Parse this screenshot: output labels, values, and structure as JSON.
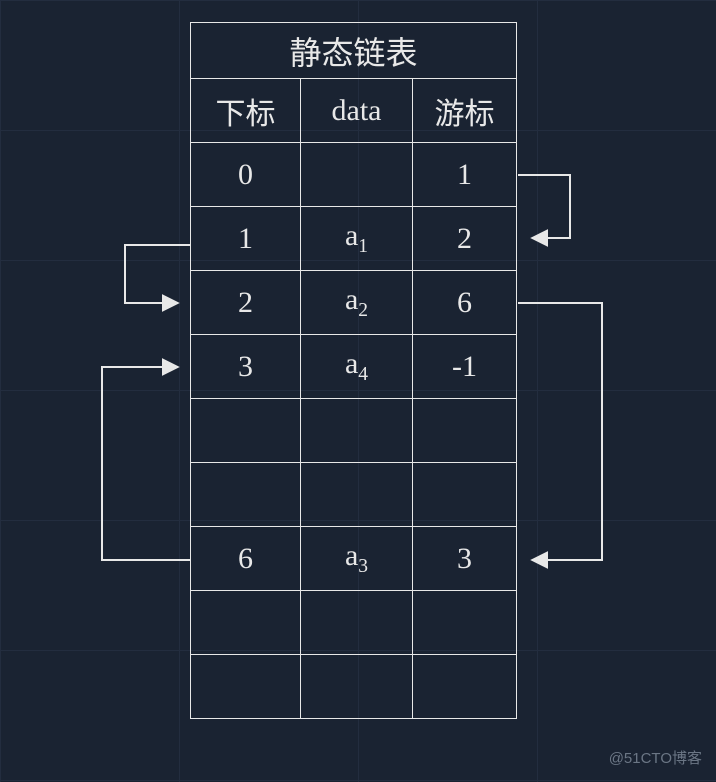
{
  "title": "静态链表",
  "headers": {
    "index": "下标",
    "data": "data",
    "cursor": "游标"
  },
  "rows": [
    {
      "index": "0",
      "data": "",
      "sub": "",
      "cursor": "1"
    },
    {
      "index": "1",
      "data": "a",
      "sub": "1",
      "cursor": "2"
    },
    {
      "index": "2",
      "data": "a",
      "sub": "2",
      "cursor": "6"
    },
    {
      "index": "3",
      "data": "a",
      "sub": "4",
      "cursor": "-1"
    },
    {
      "index": "",
      "data": "",
      "sub": "",
      "cursor": ""
    },
    {
      "index": "",
      "data": "",
      "sub": "",
      "cursor": ""
    },
    {
      "index": "6",
      "data": "a",
      "sub": "3",
      "cursor": "3"
    },
    {
      "index": "",
      "data": "",
      "sub": "",
      "cursor": ""
    },
    {
      "index": "",
      "data": "",
      "sub": "",
      "cursor": ""
    }
  ],
  "watermark": "@51CTO博客"
}
